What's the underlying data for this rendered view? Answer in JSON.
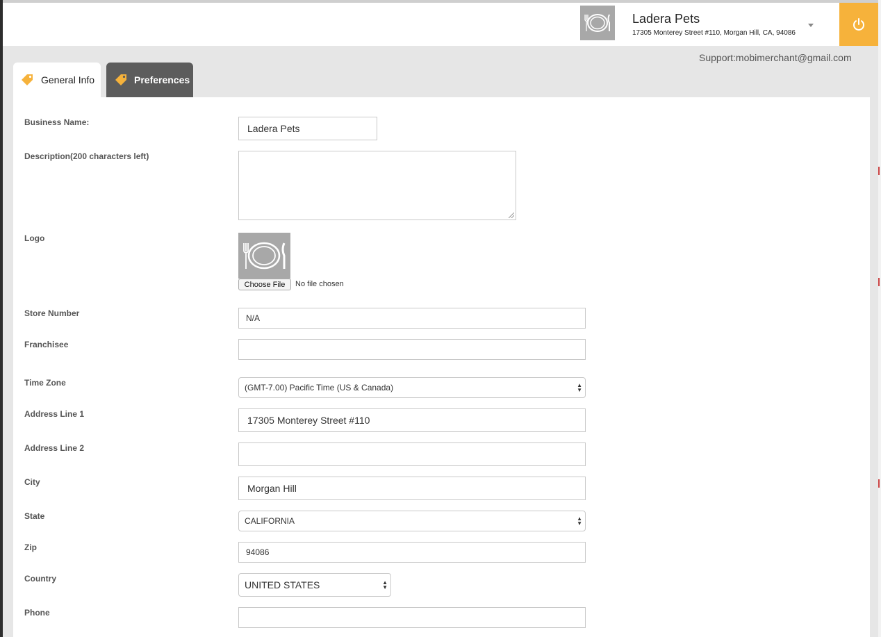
{
  "header": {
    "business_name": "Ladera Pets",
    "business_address": "17305 Monterey Street #110, Morgan Hill, CA, 94086",
    "avatar_icon": "plate-cutlery-icon",
    "dropdown_icon": "caret-down-icon",
    "power_icon": "power-icon",
    "accent_color": "#f6b23b"
  },
  "support": {
    "text": "Support:mobimerchant@gmail.com"
  },
  "tabs": [
    {
      "label": "General Info",
      "active": true,
      "icon": "tag-icon"
    },
    {
      "label": "Preferences",
      "active": false,
      "icon": "tag-icon"
    }
  ],
  "form": {
    "business_name": {
      "label": "Business Name:",
      "value": "Ladera Pets"
    },
    "description": {
      "label": "Description(200 characters left)",
      "value": ""
    },
    "logo": {
      "label": "Logo",
      "choose_file": "Choose File",
      "file_status": "No file chosen"
    },
    "store_number": {
      "label": "Store Number",
      "value": "N/A"
    },
    "franchisee": {
      "label": "Franchisee",
      "value": ""
    },
    "time_zone": {
      "label": "Time Zone",
      "value": "(GMT-7.00) Pacific Time (US & Canada)"
    },
    "address_line_1": {
      "label": "Address Line 1",
      "value": "17305 Monterey Street #110"
    },
    "address_line_2": {
      "label": "Address Line 2",
      "value": ""
    },
    "city": {
      "label": "City",
      "value": "Morgan Hill"
    },
    "state": {
      "label": "State",
      "value": "CALIFORNIA"
    },
    "zip": {
      "label": "Zip",
      "value": "94086"
    },
    "country": {
      "label": "Country",
      "value": "UNITED STATES"
    },
    "phone": {
      "label": "Phone",
      "value": ""
    }
  }
}
